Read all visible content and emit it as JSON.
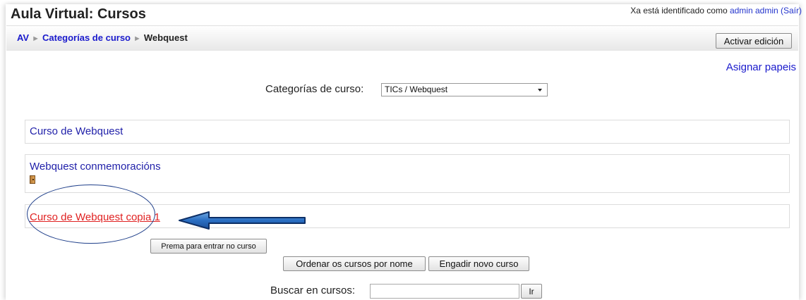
{
  "header": {
    "site_title": "Aula Virtual: Cursos",
    "login_prefix": "Xa está identificado como ",
    "login_user": "admin admin",
    "logout_label": "(Saír)"
  },
  "navbar": {
    "breadcrumb": [
      "AV",
      "Categorías de curso",
      "Webquest"
    ],
    "separator": "►",
    "edit_button": "Activar edición"
  },
  "assign_roles_link": "Asignar papeis",
  "category_selector": {
    "label": "Categorías de curso:",
    "selected": "TICs / Webquest"
  },
  "courses": [
    {
      "name": "Curso de Webquest",
      "guest_access": false,
      "highlighted": false
    },
    {
      "name": "Webquest conmemoracións",
      "guest_access": true,
      "highlighted": false
    },
    {
      "name": "Curso de Webquest copia 1",
      "guest_access": false,
      "highlighted": true
    }
  ],
  "enter_course_button": "Prema para entrar no curso",
  "actions": {
    "sort_button": "Ordenar os cursos por nome",
    "add_button": "Engadir novo curso"
  },
  "search": {
    "label": "Buscar en cursos:",
    "value": "",
    "go_button": "Ir"
  },
  "colors": {
    "link": "#1a1acc",
    "highlight_link": "#e02222",
    "annotation": "#1f3f8a"
  }
}
